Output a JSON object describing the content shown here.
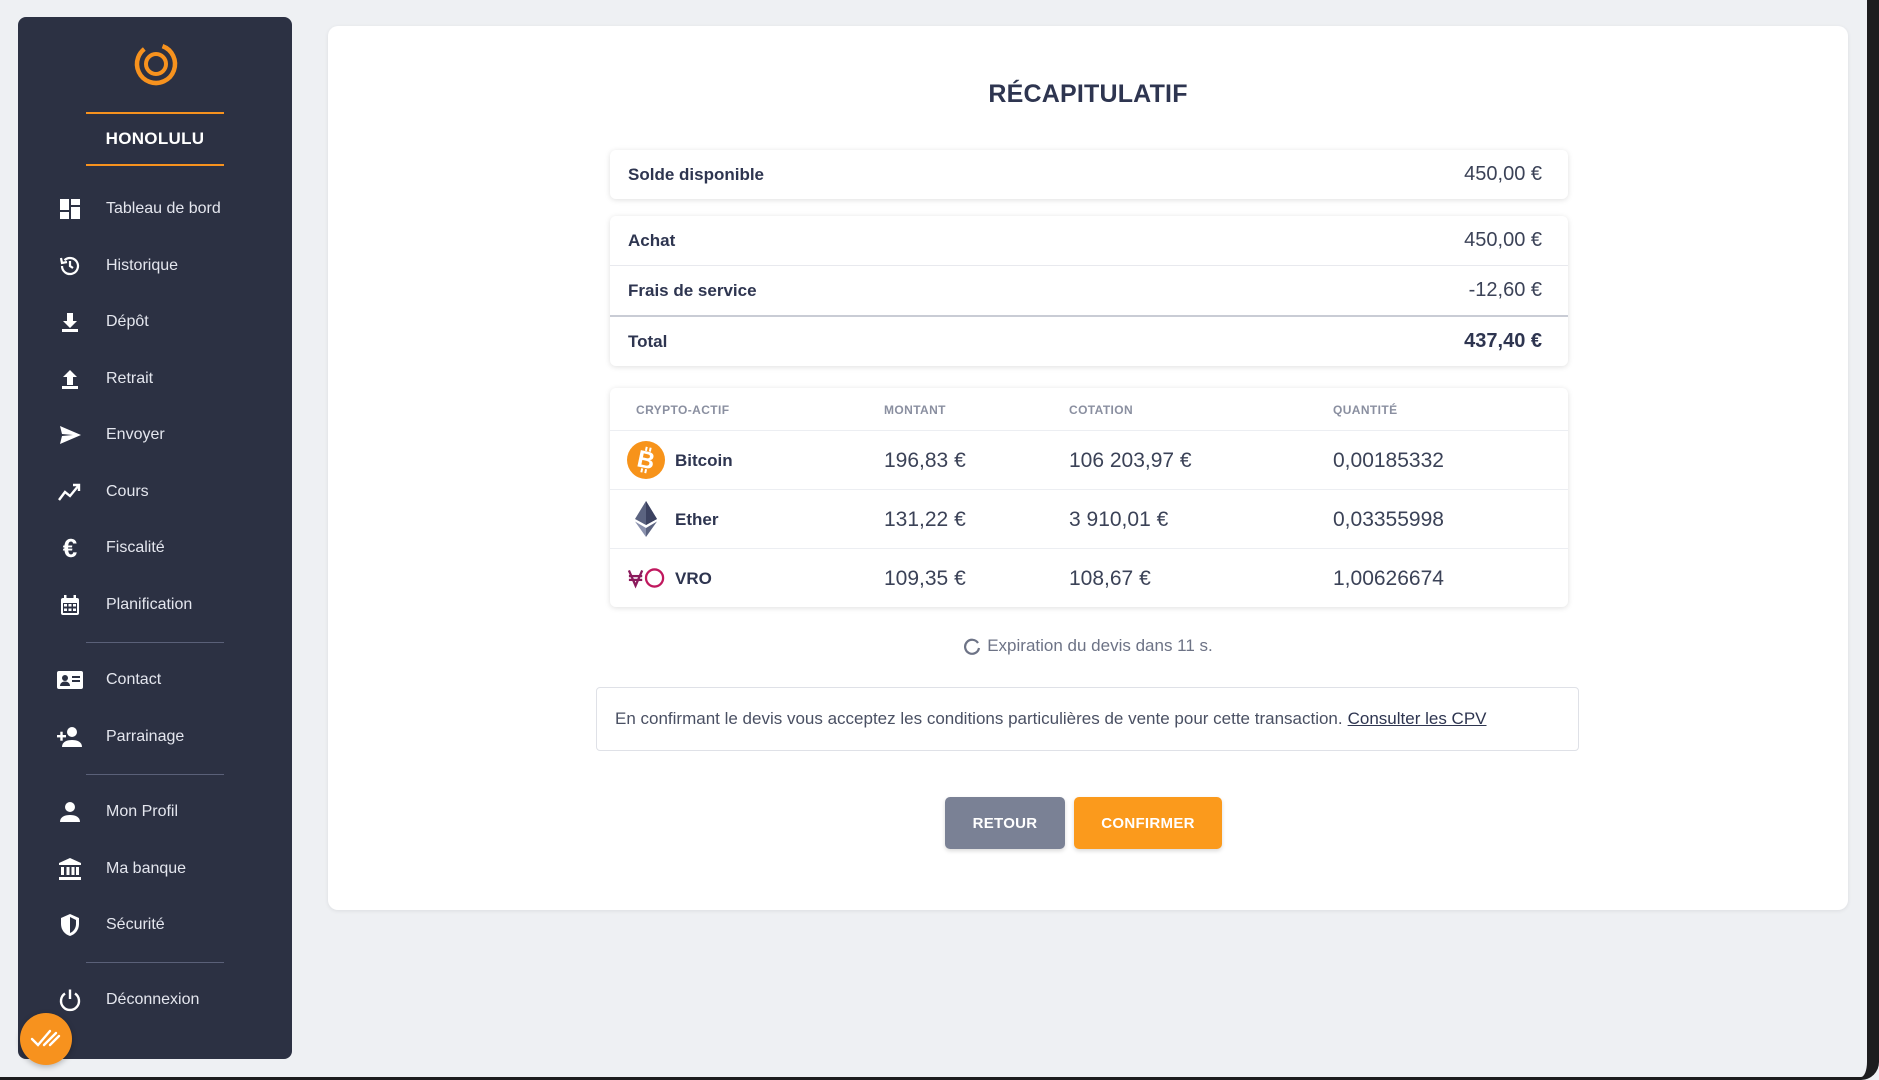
{
  "sidebar": {
    "brand": "HONOLULU",
    "items": [
      {
        "label": "Tableau de bord",
        "icon": "dashboard-icon"
      },
      {
        "label": "Historique",
        "icon": "history-icon"
      },
      {
        "label": "Dépôt",
        "icon": "download-icon"
      },
      {
        "label": "Retrait",
        "icon": "upload-icon"
      },
      {
        "label": "Envoyer",
        "icon": "send-icon"
      },
      {
        "label": "Cours",
        "icon": "chart-icon"
      },
      {
        "label": "Fiscalité",
        "icon": "euro-icon"
      },
      {
        "label": "Planification",
        "icon": "calendar-icon"
      },
      {
        "label": "Contact",
        "icon": "contact-card-icon"
      },
      {
        "label": "Parrainage",
        "icon": "add-user-icon"
      },
      {
        "label": "Mon Profil",
        "icon": "user-icon"
      },
      {
        "label": "Ma banque",
        "icon": "bank-icon"
      },
      {
        "label": "Sécurité",
        "icon": "shield-icon"
      },
      {
        "label": "Déconnexion",
        "icon": "power-icon"
      }
    ]
  },
  "main": {
    "title": "RÉCAPITULATIF",
    "balance": {
      "label": "Solde disponible",
      "value": "450,00 €"
    },
    "summary": [
      {
        "label": "Achat",
        "value": "450,00 €"
      },
      {
        "label": "Frais de service",
        "value": "-12,60 €"
      },
      {
        "label": "Total",
        "value": "437,40 €"
      }
    ],
    "table": {
      "headers": [
        "CRYPTO-ACTIF",
        "MONTANT",
        "COTATION",
        "QUANTITÉ"
      ],
      "rows": [
        {
          "name": "Bitcoin",
          "icon": "bitcoin-icon",
          "amount": "196,83 €",
          "quote": "106 203,97 €",
          "quantity": "0,00185332"
        },
        {
          "name": "Ether",
          "icon": "ether-icon",
          "amount": "131,22 €",
          "quote": "3 910,01 €",
          "quantity": "0,03355998"
        },
        {
          "name": "VRO",
          "icon": "vro-icon",
          "amount": "109,35 €",
          "quote": "108,67 €",
          "quantity": "1,00626674"
        }
      ]
    },
    "expiry": "Expiration du devis dans 11 s.",
    "notice": {
      "text": "En confirmant le devis vous acceptez les conditions particulières de vente pour cette transaction.",
      "link": "Consulter les CPV"
    },
    "buttons": {
      "back": "RETOUR",
      "confirm": "CONFIRMER"
    }
  },
  "colors": {
    "accent": "#f7921e",
    "sidebar_bg": "#2c3143",
    "back_button": "#7a8195",
    "confirm_button": "#fb9a1c"
  }
}
